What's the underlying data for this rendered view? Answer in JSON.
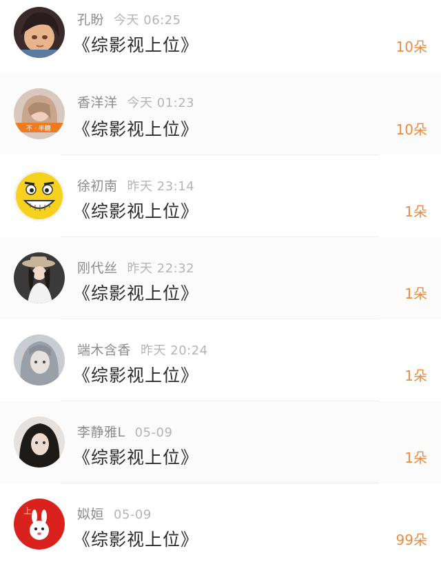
{
  "colors": {
    "accent": "#f08a3a",
    "name": "#8c8c8c",
    "time": "#b4b4b4",
    "title": "#2b2b2b"
  },
  "items": [
    {
      "name": "孔盼",
      "time": "今天 06:25",
      "title": "《综影视上位》",
      "amount": "10朵",
      "avatar": "avatar-girl-anime"
    },
    {
      "name": "香洋洋",
      "time": "今天 01:23",
      "title": "《综影视上位》",
      "amount": "10朵",
      "avatar": "avatar-girl-orange-banner"
    },
    {
      "name": "徐初南",
      "time": "昨天 23:14",
      "title": "《综影视上位》",
      "amount": "1朵",
      "avatar": "avatar-yellow-smiley"
    },
    {
      "name": "刚代丝",
      "time": "昨天 22:32",
      "title": "《综影视上位》",
      "amount": "1朵",
      "avatar": "avatar-girl-hat"
    },
    {
      "name": "端木含香",
      "time": "昨天 20:24",
      "title": "《综影视上位》",
      "amount": "1朵",
      "avatar": "avatar-girl-grey-hair"
    },
    {
      "name": "李静雅L",
      "time": "05-09",
      "title": "《综影视上位》",
      "amount": "1朵",
      "avatar": "avatar-girl-dark"
    },
    {
      "name": "姒姮",
      "time": "05-09",
      "title": "《综影视上位》",
      "amount": "99朵",
      "avatar": "avatar-red-rabbit"
    }
  ]
}
